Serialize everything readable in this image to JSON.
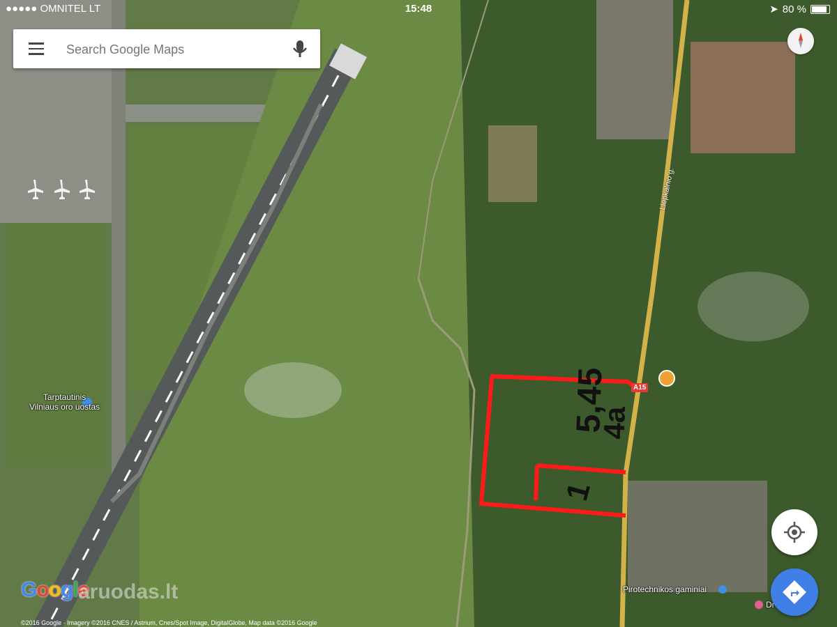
{
  "status_bar": {
    "carrier": "●●●●● OMNITEL LT",
    "time": "15:48",
    "battery": "80 %"
  },
  "search": {
    "placeholder": "Search Google Maps"
  },
  "map_labels": {
    "airport": [
      "Tarptautinis",
      "Vilniaus oro uostas"
    ],
    "road": "Liepkalnio g.",
    "route": "A15",
    "poi_fireworks": "Pirotechnikos gaminiai",
    "poi_bottom_right": "Dr"
  },
  "annotations": {
    "text_area_1": "5,45",
    "text_area_2": "4a",
    "text_area_3": "1"
  },
  "footer": {
    "copyright": "©2016 Google · Imagery ©2016 CNES / Astrium, Cnes/Spot Image, DigitalGlobe, Map data ©2016 Google",
    "google_logo": "Google",
    "watermark": "aruodas.lt"
  },
  "icons": [
    "menu-icon",
    "microphone-icon",
    "compass-icon",
    "my-location-icon",
    "directions-icon",
    "airport-icon",
    "fireworks-icon",
    "restaurant-icon"
  ],
  "colors": {
    "annotation_red": "#ff1a1a",
    "directions_blue": "#3f7fe6",
    "road_yellow": "#d4b24a"
  }
}
